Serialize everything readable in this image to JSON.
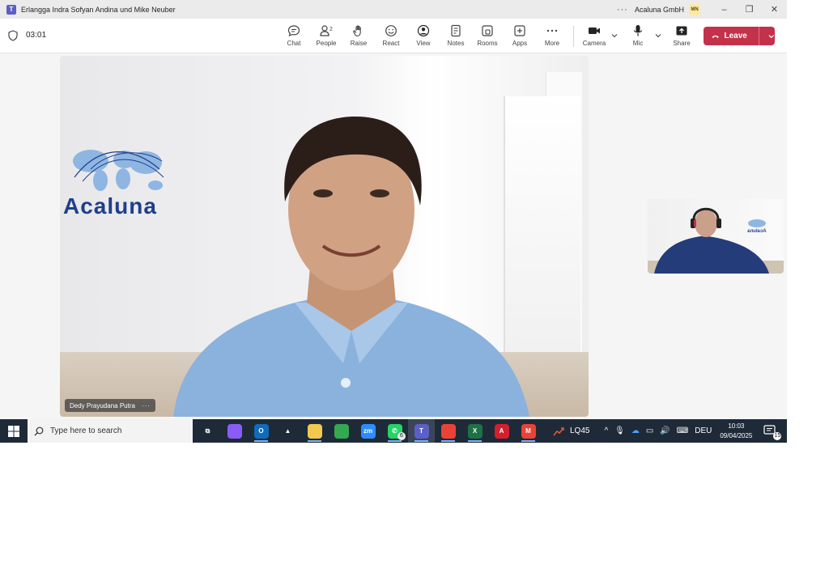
{
  "titlebar": {
    "title": "Erlangga Indra Sofyan Andina und Mike Neuber",
    "more_label": "···",
    "org": "Acaluna GmbH",
    "avatar_initials": "MN",
    "minimize": "–",
    "restore": "❐",
    "close": "✕"
  },
  "toolbar": {
    "timer": "03:01",
    "items": [
      {
        "label": "Chat",
        "icon": "chat-icon"
      },
      {
        "label": "People",
        "icon": "people-icon",
        "count": "2"
      },
      {
        "label": "Raise",
        "icon": "raise-hand-icon"
      },
      {
        "label": "React",
        "icon": "react-icon"
      },
      {
        "label": "View",
        "icon": "view-icon"
      },
      {
        "label": "Notes",
        "icon": "notes-icon"
      },
      {
        "label": "Rooms",
        "icon": "rooms-icon"
      },
      {
        "label": "Apps",
        "icon": "apps-icon"
      },
      {
        "label": "More",
        "icon": "more-icon"
      }
    ],
    "camera_label": "Camera",
    "mic_label": "Mic",
    "share_label": "Share",
    "leave_label": "Leave",
    "leave_color": "#c4314b"
  },
  "stage": {
    "participant_name": "Dedy Prayudana Putra",
    "name_more": "···",
    "logo_text": "Acaluna",
    "logo_color": "#1f3f8a"
  },
  "selfview": {
    "logo_text": "Acaluna"
  },
  "taskbar": {
    "search_placeholder": "Type here to search",
    "apps": [
      {
        "name": "task-view",
        "glyph": "⧉",
        "color": "#1f2a38"
      },
      {
        "name": "copilot",
        "glyph": "",
        "color": "#8a5cf6"
      },
      {
        "name": "outlook",
        "glyph": "O",
        "color": "#0f6cbd"
      },
      {
        "name": "azure-devops",
        "glyph": "▲",
        "color": "#1f2a38"
      },
      {
        "name": "file-explorer",
        "glyph": "",
        "color": "#f2c94c"
      },
      {
        "name": "chrome",
        "glyph": "",
        "color": "#34a853"
      },
      {
        "name": "zoom",
        "glyph": "zm",
        "color": "#2d8cff"
      },
      {
        "name": "whatsapp",
        "glyph": "✆",
        "color": "#25d366",
        "badge": "6"
      },
      {
        "name": "teams",
        "glyph": "T",
        "color": "#5b5fc7"
      },
      {
        "name": "chrome-profile",
        "glyph": "",
        "color": "#ea4335"
      },
      {
        "name": "excel",
        "glyph": "X",
        "color": "#1e7145"
      },
      {
        "name": "acrobat",
        "glyph": "A",
        "color": "#d4202c"
      },
      {
        "name": "chrome-gmail",
        "glyph": "M",
        "color": "#ea4335"
      }
    ],
    "stock_label": "LQ45",
    "language": "DEU",
    "time": "10:03",
    "date": "09/04/2025",
    "notification_count": "15"
  }
}
